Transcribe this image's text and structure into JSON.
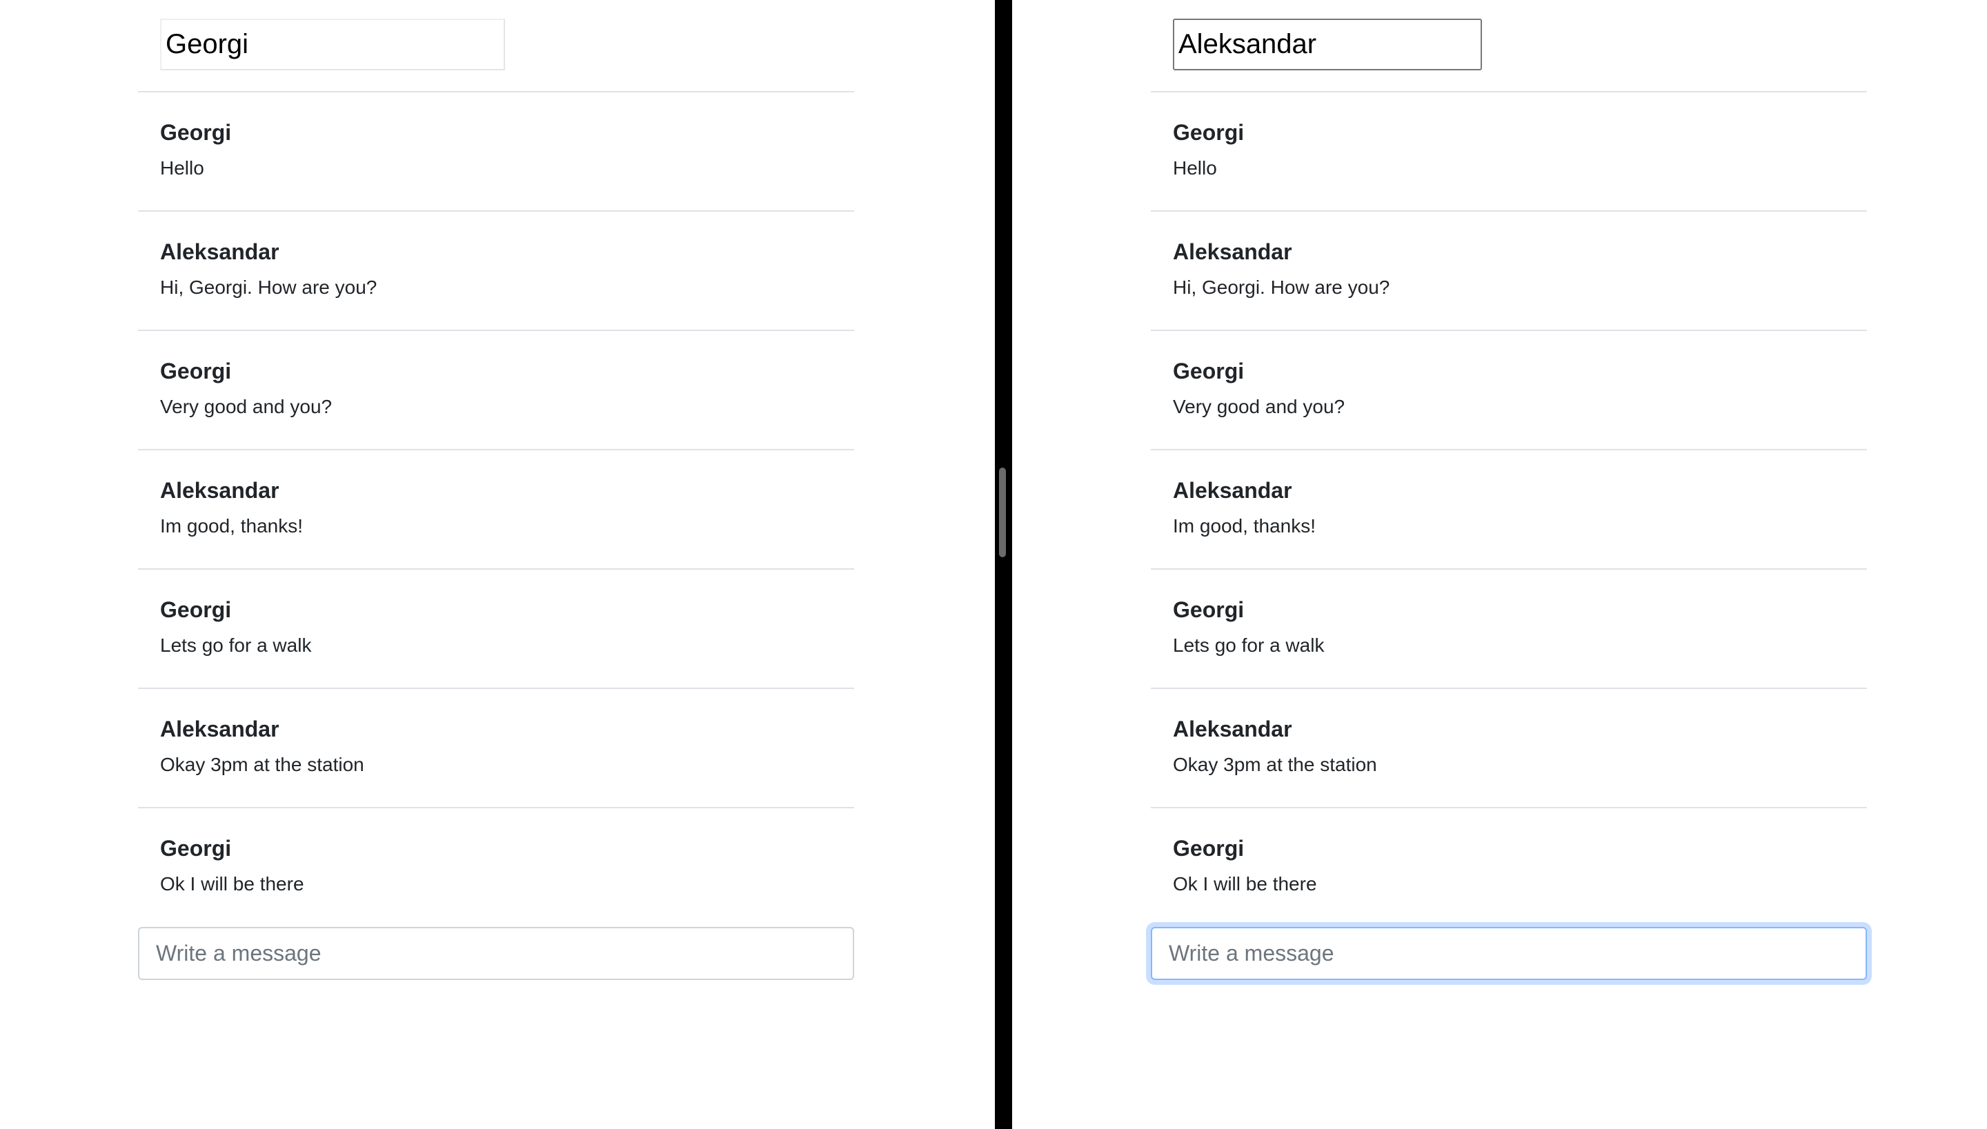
{
  "left_pane": {
    "username_value": "Georgi",
    "messages": [
      {
        "author": "Georgi",
        "text": "Hello"
      },
      {
        "author": "Aleksandar",
        "text": "Hi, Georgi. How are you?"
      },
      {
        "author": "Georgi",
        "text": "Very good and you?"
      },
      {
        "author": "Aleksandar",
        "text": "Im good, thanks!"
      },
      {
        "author": "Georgi",
        "text": "Lets go for a walk"
      },
      {
        "author": "Aleksandar",
        "text": "Okay 3pm at the station"
      },
      {
        "author": "Georgi",
        "text": "Ok I will be there"
      }
    ],
    "compose_placeholder": "Write a message"
  },
  "right_pane": {
    "username_value": "Aleksandar",
    "messages": [
      {
        "author": "Georgi",
        "text": "Hello"
      },
      {
        "author": "Aleksandar",
        "text": "Hi, Georgi. How are you?"
      },
      {
        "author": "Georgi",
        "text": "Very good and you?"
      },
      {
        "author": "Aleksandar",
        "text": "Im good, thanks!"
      },
      {
        "author": "Georgi",
        "text": "Lets go for a walk"
      },
      {
        "author": "Aleksandar",
        "text": "Okay 3pm at the station"
      },
      {
        "author": "Georgi",
        "text": "Ok I will be there"
      }
    ],
    "compose_placeholder": "Write a message"
  },
  "colors": {
    "divider": "#000000",
    "row_border": "#dee2e6",
    "focus_ring": "#86b7fe"
  }
}
